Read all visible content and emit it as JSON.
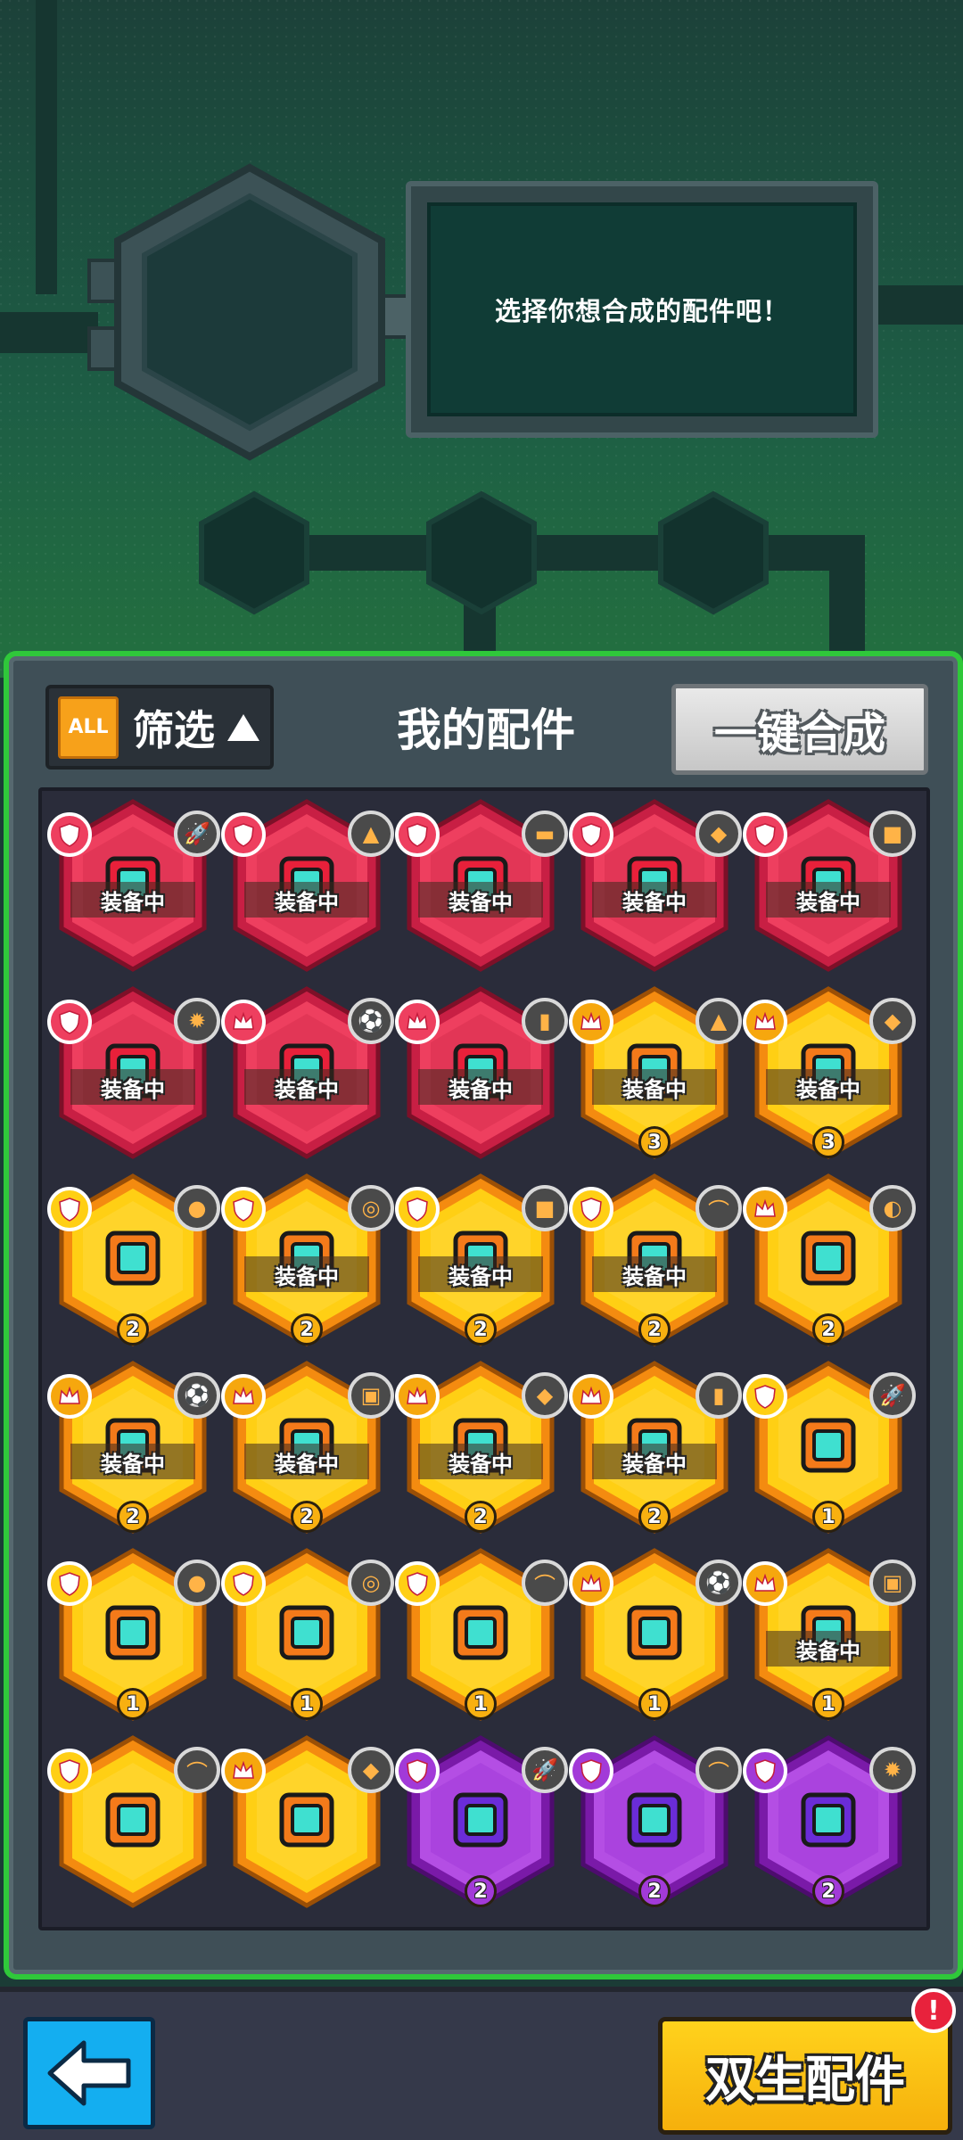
{
  "machine": {
    "message": "选择你想合成的配件吧！"
  },
  "panel": {
    "filter_badge": "ALL",
    "filter_label": "筛选",
    "title": "我的配件",
    "merge_all_label": "一键合成"
  },
  "colors": {
    "red": "#ee3f5f",
    "yellow": "#ffcf14",
    "purple": "#a93ad8",
    "green_border": "#2fc83a"
  },
  "parts": [
    {
      "rarity": "red",
      "equipped": true,
      "equip_label": "装备中",
      "level": "",
      "rank": "red",
      "companion": "rocket-icon",
      "glow": true,
      "icon": "ring-gun"
    },
    {
      "rarity": "red",
      "equipped": true,
      "equip_label": "装备中",
      "level": "",
      "rank": "red",
      "companion": "cone-icon",
      "glow": true,
      "icon": "twin-block"
    },
    {
      "rarity": "red",
      "equipped": true,
      "equip_label": "装备中",
      "level": "",
      "rank": "red",
      "companion": "dumbbell-icon",
      "glow": true,
      "icon": "box-launcher"
    },
    {
      "rarity": "red",
      "equipped": true,
      "equip_label": "装备中",
      "level": "",
      "rank": "red",
      "companion": "card-icon",
      "glow": true,
      "icon": "pillar"
    },
    {
      "rarity": "red",
      "equipped": true,
      "equip_label": "装备中",
      "level": "",
      "rank": "shield",
      "companion": "brick-icon",
      "glow": false,
      "icon": "tower"
    },
    {
      "rarity": "red",
      "equipped": true,
      "equip_label": "装备中",
      "level": "",
      "rank": "shield",
      "companion": "gear-icon",
      "glow": false,
      "icon": "cart"
    },
    {
      "rarity": "red",
      "equipped": true,
      "equip_label": "装备中",
      "level": "",
      "rank": "crown",
      "companion": "ball-icon",
      "glow": false,
      "icon": "twin-eye"
    },
    {
      "rarity": "red",
      "equipped": true,
      "equip_label": "装备中",
      "level": "",
      "rank": "crown",
      "companion": "bottle-icon",
      "glow": false,
      "icon": "claw"
    },
    {
      "rarity": "yellow",
      "equipped": true,
      "equip_label": "装备中",
      "level": "3",
      "rank": "crown",
      "companion": "cone-icon",
      "glow": false,
      "icon": "visor"
    },
    {
      "rarity": "yellow",
      "equipped": true,
      "equip_label": "装备中",
      "level": "3",
      "rank": "crown",
      "companion": "card-icon",
      "glow": false,
      "icon": "bracket"
    },
    {
      "rarity": "yellow",
      "equipped": false,
      "equip_label": "",
      "level": "2",
      "rank": "shield",
      "companion": "melon-icon",
      "glow": false,
      "icon": "coil"
    },
    {
      "rarity": "yellow",
      "equipped": true,
      "equip_label": "装备中",
      "level": "2",
      "rank": "shield",
      "companion": "wheel-icon",
      "glow": false,
      "icon": "spool"
    },
    {
      "rarity": "yellow",
      "equipped": true,
      "equip_label": "装备中",
      "level": "2",
      "rank": "shield",
      "companion": "brick-icon",
      "glow": false,
      "icon": "bot-head"
    },
    {
      "rarity": "yellow",
      "equipped": true,
      "equip_label": "装备中",
      "level": "2",
      "rank": "shield",
      "companion": "arc-icon",
      "glow": false,
      "icon": "traffic"
    },
    {
      "rarity": "yellow",
      "equipped": false,
      "equip_label": "",
      "level": "2",
      "rank": "crown",
      "companion": "shell-icon",
      "glow": false,
      "icon": "saucer"
    },
    {
      "rarity": "yellow",
      "equipped": true,
      "equip_label": "装备中",
      "level": "2",
      "rank": "crown",
      "companion": "ball-icon",
      "glow": false,
      "icon": "lens"
    },
    {
      "rarity": "yellow",
      "equipped": true,
      "equip_label": "装备中",
      "level": "2",
      "rank": "crown",
      "companion": "camera-icon",
      "glow": false,
      "icon": "dome"
    },
    {
      "rarity": "yellow",
      "equipped": true,
      "equip_label": "装备中",
      "level": "2",
      "rank": "crown",
      "companion": "card-icon",
      "glow": false,
      "icon": "bracket"
    },
    {
      "rarity": "yellow",
      "equipped": true,
      "equip_label": "装备中",
      "level": "2",
      "rank": "crown",
      "companion": "bottle-icon",
      "glow": false,
      "icon": "triangle"
    },
    {
      "rarity": "yellow",
      "equipped": false,
      "equip_label": "",
      "level": "1",
      "rank": "shield",
      "companion": "rocket-icon",
      "glow": false,
      "icon": "wing"
    },
    {
      "rarity": "yellow",
      "equipped": false,
      "equip_label": "",
      "level": "1",
      "rank": "shield",
      "companion": "melon-icon",
      "glow": false,
      "icon": "coil"
    },
    {
      "rarity": "yellow",
      "equipped": false,
      "equip_label": "",
      "level": "1",
      "rank": "shield",
      "companion": "wheel-icon",
      "glow": false,
      "icon": "spool"
    },
    {
      "rarity": "yellow",
      "equipped": false,
      "equip_label": "",
      "level": "1",
      "rank": "shield",
      "companion": "arc-icon",
      "glow": false,
      "icon": "traffic"
    },
    {
      "rarity": "yellow",
      "equipped": false,
      "equip_label": "",
      "level": "1",
      "rank": "crown",
      "companion": "ball-icon",
      "glow": false,
      "icon": "lens"
    },
    {
      "rarity": "yellow",
      "equipped": true,
      "equip_label": "装备中",
      "level": "1",
      "rank": "crown",
      "companion": "camera-icon",
      "glow": false,
      "icon": "dome"
    },
    {
      "rarity": "yellow",
      "equipped": false,
      "equip_label": "",
      "level": "",
      "rank": "shield",
      "companion": "arc-icon",
      "glow": false,
      "icon": "traffic"
    },
    {
      "rarity": "yellow",
      "equipped": false,
      "equip_label": "",
      "level": "",
      "rank": "crown",
      "companion": "card-icon",
      "glow": false,
      "icon": "bracket"
    },
    {
      "rarity": "purple",
      "equipped": false,
      "equip_label": "",
      "level": "2",
      "rank": "shield",
      "companion": "rocket-icon",
      "glow": false,
      "icon": "wing"
    },
    {
      "rarity": "purple",
      "equipped": false,
      "equip_label": "",
      "level": "2",
      "rank": "shield",
      "companion": "arc-icon",
      "glow": false,
      "icon": "traffic"
    },
    {
      "rarity": "purple",
      "equipped": false,
      "equip_label": "",
      "level": "2",
      "rank": "shield",
      "companion": "gear-icon",
      "glow": false,
      "icon": "dome"
    }
  ],
  "bottom": {
    "twin_label": "双生配件",
    "alert": "!"
  }
}
